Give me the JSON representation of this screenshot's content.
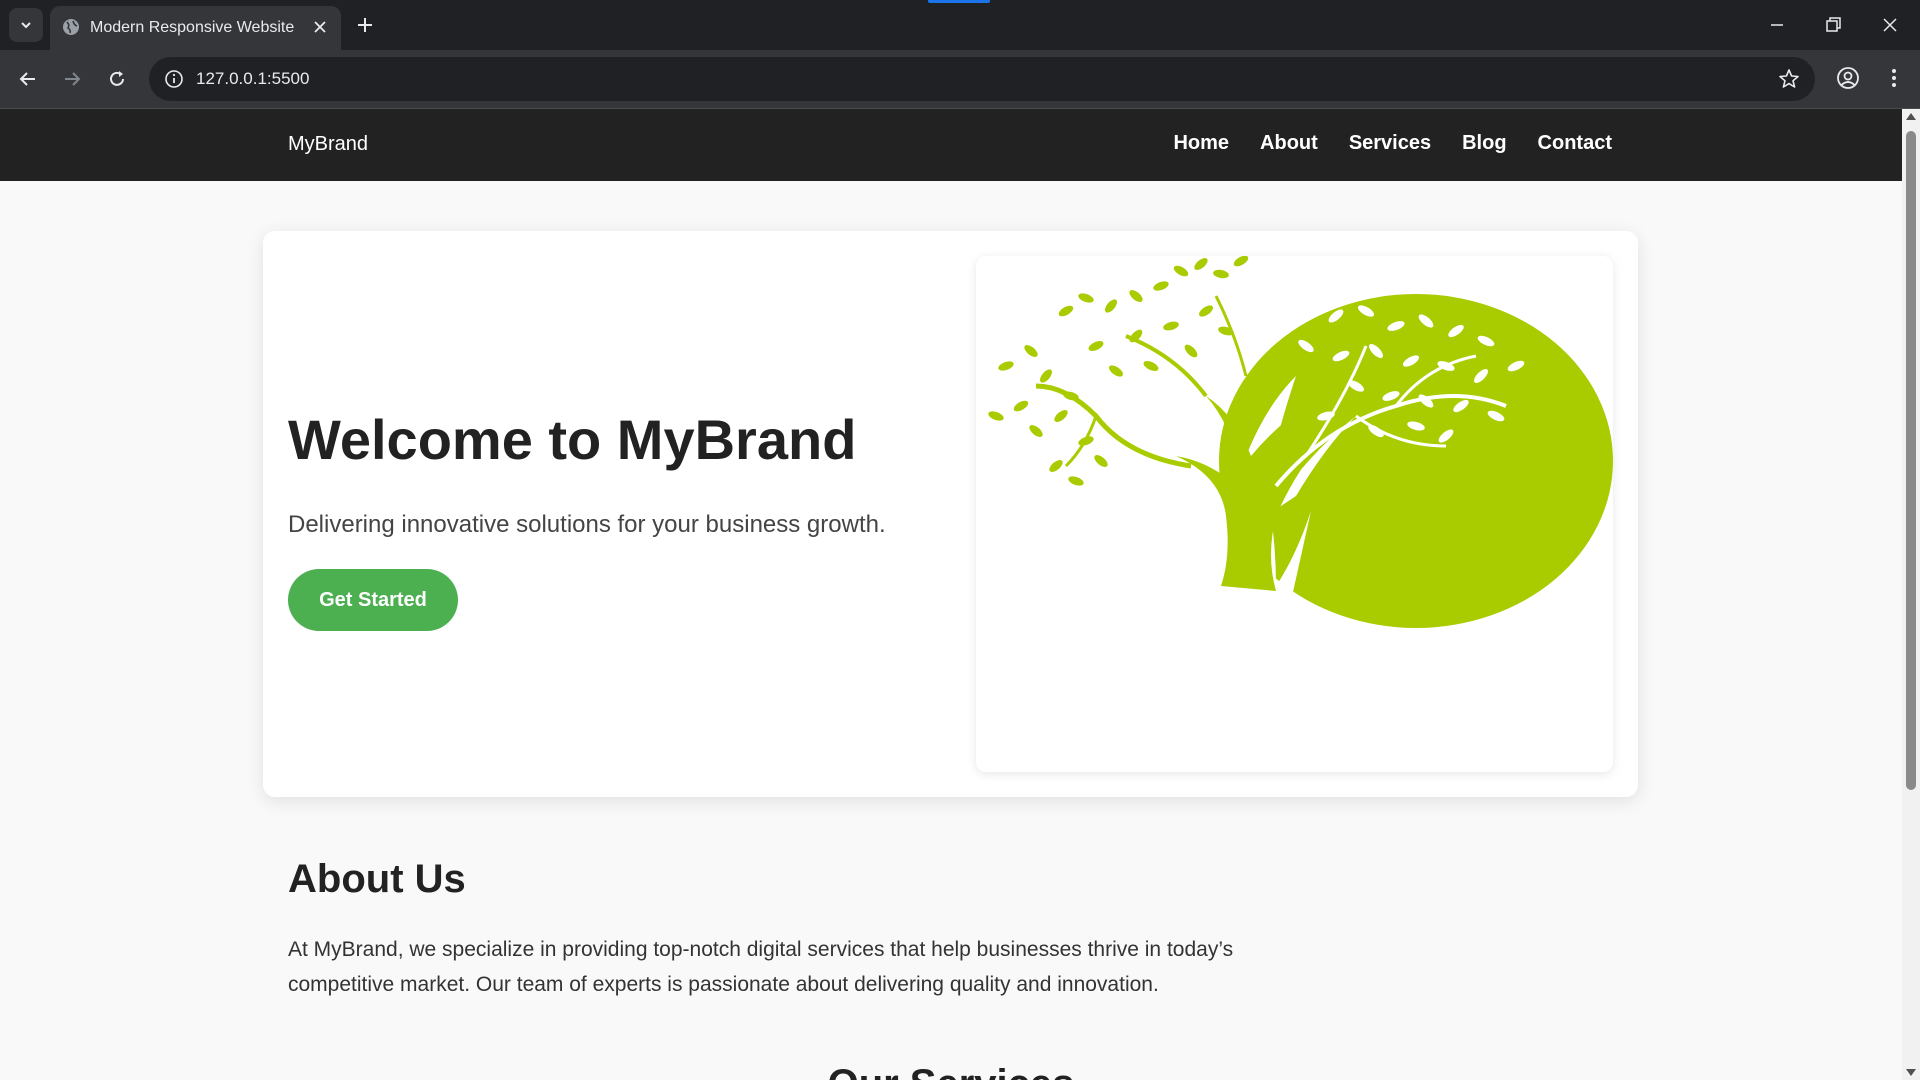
{
  "browser": {
    "tab_title": "Modern Responsive Website",
    "url": "127.0.0.1:5500"
  },
  "site": {
    "brand": "MyBrand",
    "nav": [
      "Home",
      "About",
      "Services",
      "Blog",
      "Contact"
    ]
  },
  "hero": {
    "title": "Welcome to MyBrand",
    "subtitle": "Delivering innovative solutions for your business growth.",
    "cta_label": "Get Started",
    "image_icon": "tree-logo-icon",
    "image_color": "#a8cc00"
  },
  "about": {
    "title": "About Us",
    "text": "At MyBrand, we specialize in providing top-notch digital services that help businesses thrive in today’s competitive market. Our team of experts is passionate about delivering quality and innovation."
  },
  "services": {
    "title": "Our Services"
  },
  "colors": {
    "nav_bg": "#222222",
    "accent": "#4caf50"
  }
}
